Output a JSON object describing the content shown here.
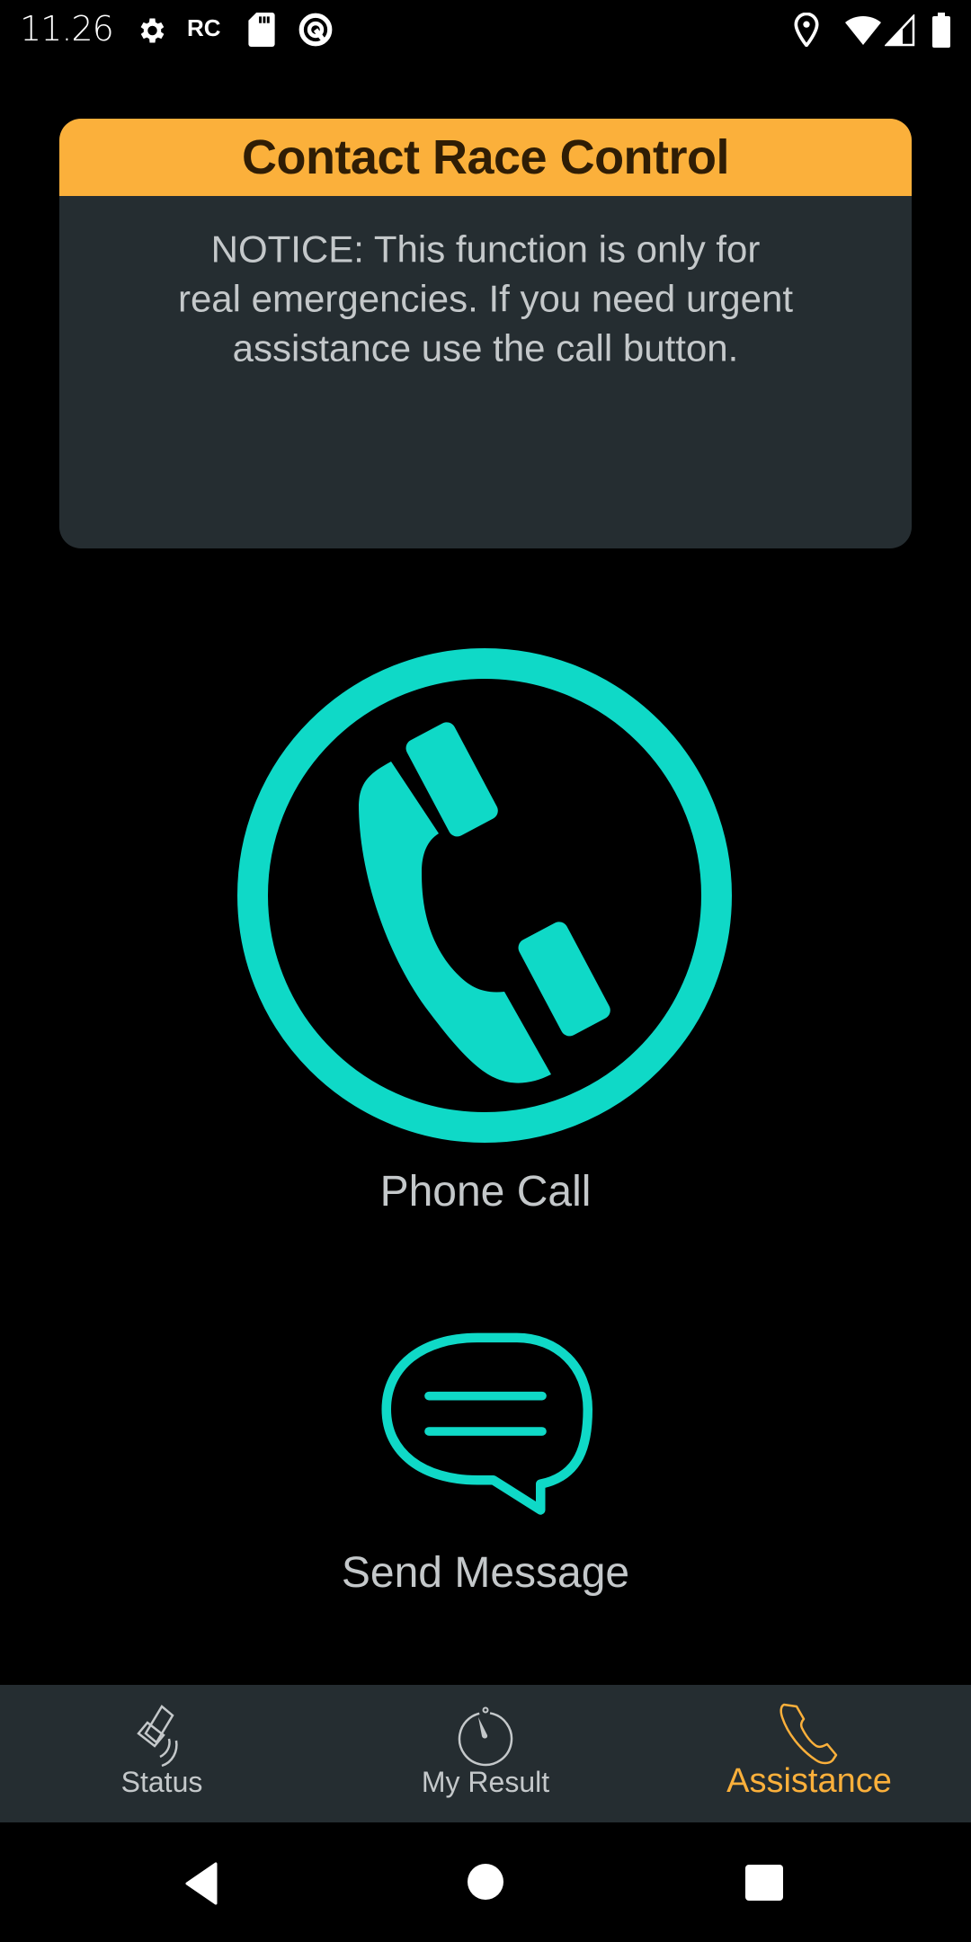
{
  "status_bar": {
    "time": "11.26",
    "left_icons": [
      "settings-gear-icon",
      "rc-text-icon",
      "sd-card-icon",
      "q-circle-icon"
    ],
    "rc_text": "RC",
    "right_icons": [
      "location-pin-icon",
      "wifi-icon",
      "cell-signal-icon",
      "battery-icon"
    ]
  },
  "card": {
    "title": "Contact Race Control",
    "notice_lines": [
      "NOTICE: This function is only for",
      "real emergencies. If you need urgent",
      "assistance use the call button."
    ]
  },
  "actions": {
    "phone_call_label": "Phone Call",
    "send_message_label": "Send Message"
  },
  "bottom_nav": {
    "items": [
      {
        "label": "Status",
        "icon": "satellite-icon",
        "active": false
      },
      {
        "label": "My Result",
        "icon": "stopwatch-icon",
        "active": false
      },
      {
        "label": "Assistance",
        "icon": "phone-icon",
        "active": true
      }
    ]
  },
  "colors": {
    "accent_orange": "#fbb03b",
    "teal": "#0fd9c7",
    "card_bg": "#252d31",
    "text_gray": "#c4c8ca"
  },
  "system_nav": [
    "back-icon",
    "home-icon",
    "recents-icon"
  ]
}
